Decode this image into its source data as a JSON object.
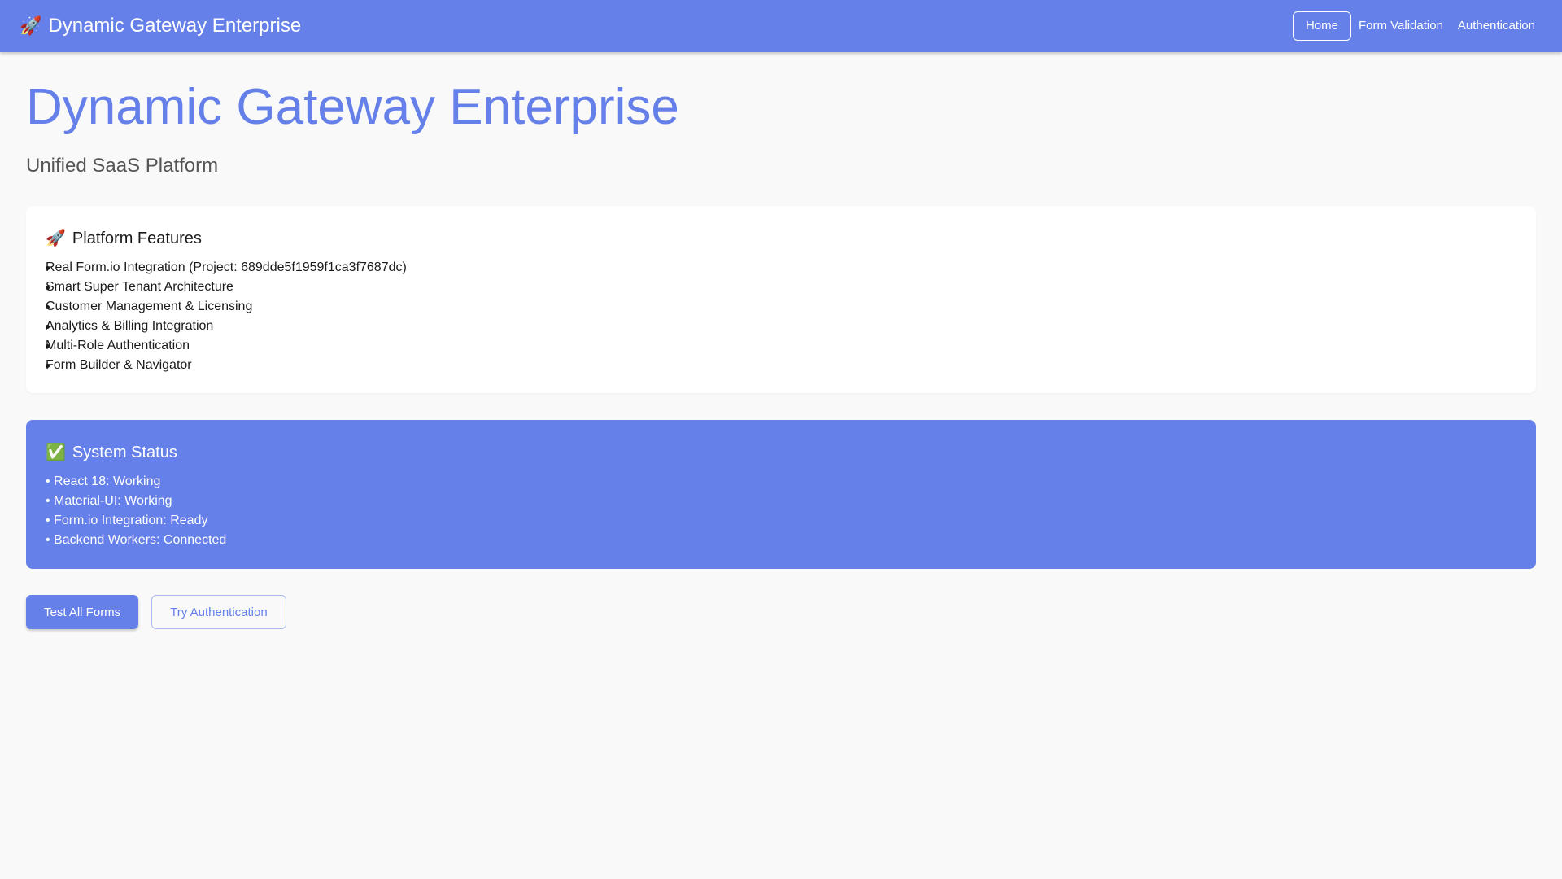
{
  "header": {
    "brand_icon": "rocket-icon",
    "brand_emoji": "🚀",
    "brand_title": "Dynamic Gateway Enterprise",
    "nav": [
      {
        "label": "Home",
        "active": true
      },
      {
        "label": "Form Validation",
        "active": false
      },
      {
        "label": "Authentication",
        "active": false
      }
    ]
  },
  "main": {
    "title": "Dynamic Gateway Enterprise",
    "subtitle": "Unified SaaS Platform"
  },
  "features": {
    "icon": "rocket-icon",
    "emoji": "🚀",
    "title": "Platform Features",
    "items": [
      "Real Form.io Integration (Project: 689dde5f1959f1ca3f7687dc)",
      "Smart Super Tenant Architecture",
      "Customer Management & Licensing",
      "Analytics & Billing Integration",
      "Multi-Role Authentication",
      "Form Builder & Navigator"
    ]
  },
  "status": {
    "icon": "check-mark-icon",
    "emoji": "✅",
    "title": "System Status",
    "lines": [
      "• React 18: Working",
      "• Material-UI: Working",
      "• Form.io Integration: Ready",
      "• Backend Workers: Connected"
    ]
  },
  "actions": {
    "primary_label": "Test All Forms",
    "secondary_label": "Try Authentication"
  },
  "colors": {
    "accent": "#6680ea",
    "background": "#f9f9f9",
    "card": "#ffffff"
  }
}
